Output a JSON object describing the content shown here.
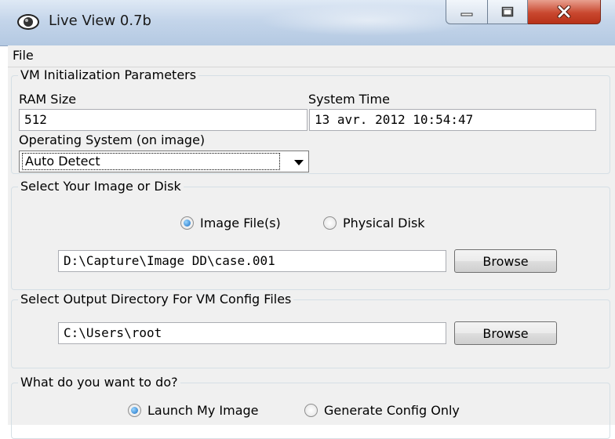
{
  "window": {
    "title": "Live View 0.7b"
  },
  "menu": {
    "file": "File"
  },
  "vm_init": {
    "group_title": "VM Initialization Parameters",
    "ram_label": "RAM Size",
    "ram_value": "512",
    "time_label": "System Time",
    "time_value": "13 avr. 2012 10:54:47",
    "os_label": "Operating System (on image)",
    "os_selected": "Auto Detect"
  },
  "image_select": {
    "group_title": "Select Your Image or Disk",
    "option_image": "Image File(s)",
    "option_disk": "Physical Disk",
    "selected": "Image File(s)",
    "path": "D:\\Capture\\Image DD\\case.001",
    "browse_label": "Browse"
  },
  "output_dir": {
    "group_title": "Select Output Directory For VM Config Files",
    "path": "C:\\Users\\root",
    "browse_label": "Browse"
  },
  "action": {
    "group_title": "What do you want to do?",
    "option_launch": "Launch My Image",
    "option_generate": "Generate Config Only",
    "selected": "Launch My Image"
  }
}
